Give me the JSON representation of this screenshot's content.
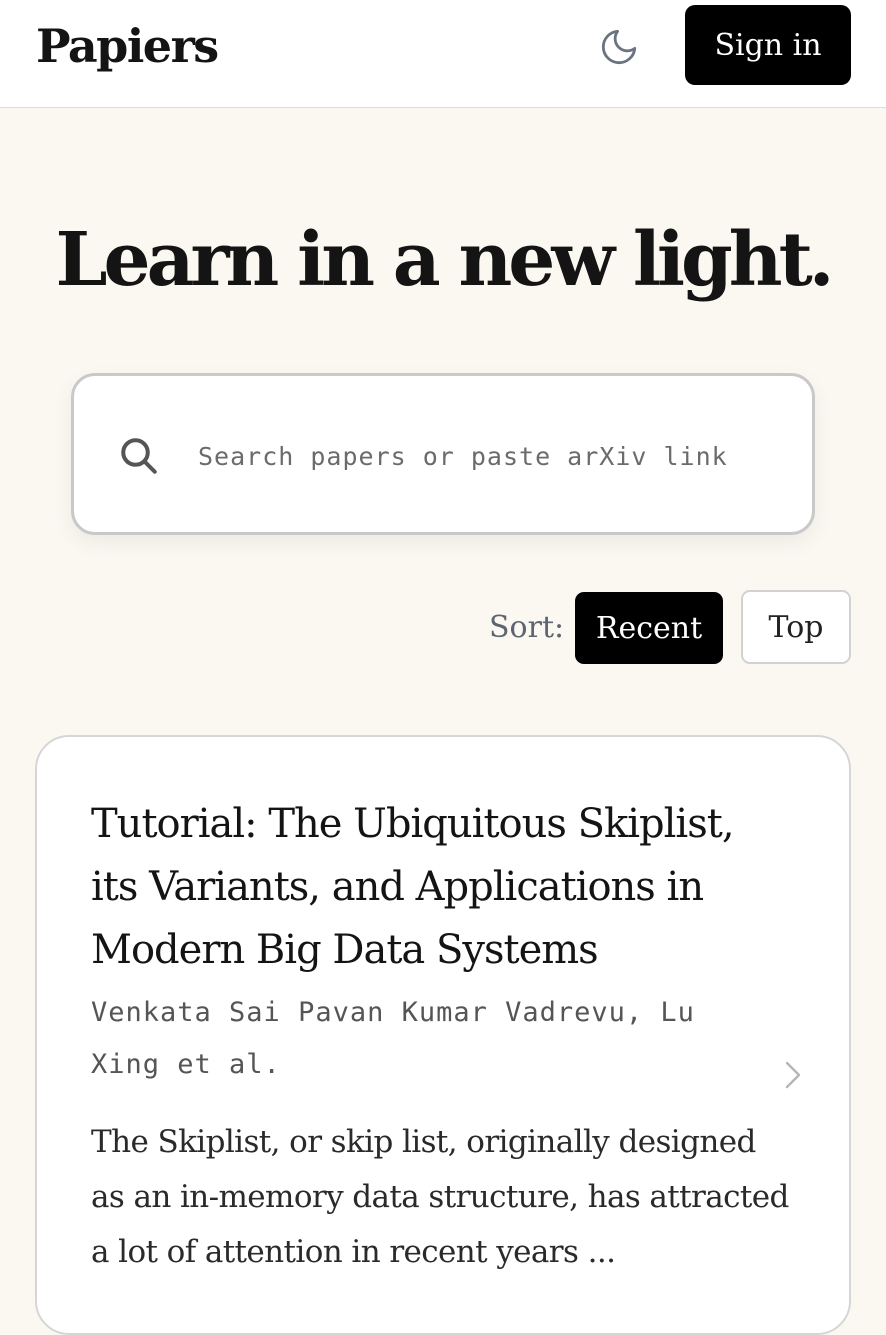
{
  "header": {
    "logo": "Papiers",
    "theme_toggle_icon": "moon-icon",
    "sign_in_label": "Sign in"
  },
  "hero": {
    "headline": "Learn in a new light."
  },
  "search": {
    "icon": "search-icon",
    "placeholder": "Search papers or paste arXiv link",
    "value": ""
  },
  "sort": {
    "label": "Sort:",
    "options": [
      "Recent",
      "Top"
    ],
    "selected": "Recent"
  },
  "papers": [
    {
      "title": "Tutorial: The Ubiquitous Skiplist, its Variants, and Applications in Modern Big Data Systems",
      "authors": "Venkata Sai Pavan Kumar Vadrevu, Lu Xing et al.",
      "abstract": "The Skiplist, or skip list, originally designed as an in-memory data structure, has attracted a lot of attention in recent years ...",
      "open_icon": "chevron-right-icon"
    }
  ],
  "colors": {
    "page_background": "#fbf8f2",
    "header_background": "#ffffff",
    "primary_button": "#000000",
    "text": "#141414",
    "muted_text": "#5e6470"
  }
}
